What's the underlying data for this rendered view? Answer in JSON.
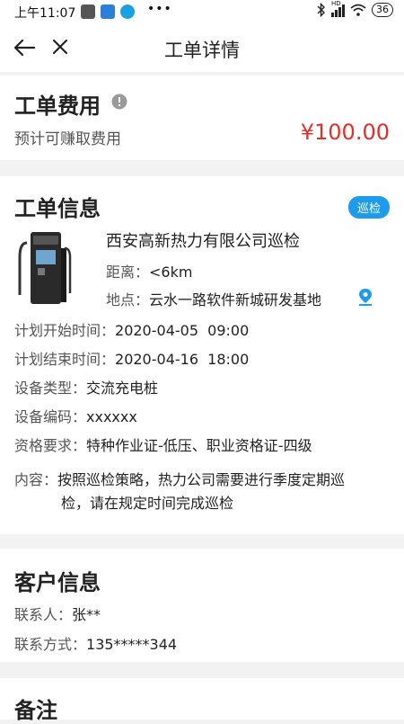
{
  "status_bar": {
    "time": "上午11:07",
    "signal_text": "HD",
    "battery": "36"
  },
  "nav": {
    "title": "工单详情"
  },
  "fee_card": {
    "title": "工单费用",
    "subtitle": "预计可赚取费用",
    "amount": "¥100.00",
    "amount_color": "#e0302a"
  },
  "info_card": {
    "title": "工单信息",
    "badge": "巡检",
    "badge_color": "#1e9bea",
    "company": "西安高新热力有限公司巡检",
    "distance_label": "距离：",
    "distance_value": "<6km",
    "location_label": "地点：",
    "location_value": "云水一路软件新城研发基地",
    "plan_start_label": "计划开始时间：",
    "plan_start_value": "2020-04-05  09:00",
    "plan_end_label": "计划结束时间：",
    "plan_end_value": "2020-04-16  18:00",
    "device_type_label": "设备类型：",
    "device_type_value": "交流充电桩",
    "device_code_label": "设备编码：",
    "device_code_value": "xxxxxx",
    "qualification_label": "资格要求：",
    "qualification_value": "特种作业证-低压、职业资格证-四级",
    "content_label": "内容：",
    "content_line1": "按照巡检策略，热力公司需要进行季度定期巡",
    "content_line2": "检，请在规定时间完成巡检"
  },
  "customer_card": {
    "title": "客户信息",
    "contact_label": "联系人：",
    "contact_value": "张**",
    "phone_label": "联系方式：",
    "phone_value": "135*****344"
  },
  "notes_card": {
    "title": "备注"
  }
}
